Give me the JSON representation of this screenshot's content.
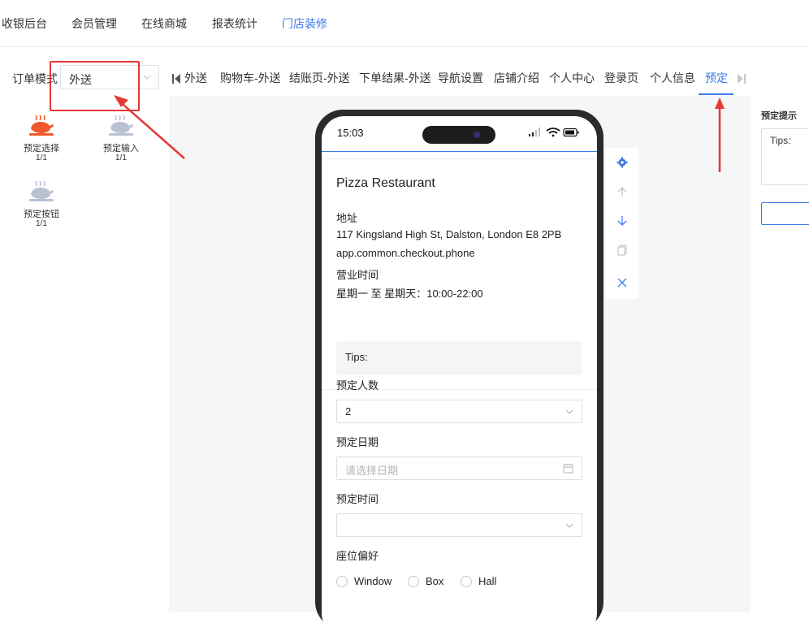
{
  "topnav": {
    "items": [
      {
        "label": "收银后台",
        "active": false
      },
      {
        "label": "会员管理",
        "active": false
      },
      {
        "label": "在线商城",
        "active": false
      },
      {
        "label": "报表统计",
        "active": false
      },
      {
        "label": "门店装修",
        "active": true
      }
    ]
  },
  "order_mode": {
    "label": "订单模式",
    "selected": "外送"
  },
  "components": [
    {
      "name": "预定选择",
      "count": "1/1",
      "icon": "roast-chicken-icon",
      "active": true
    },
    {
      "name": "预定输入",
      "count": "1/1",
      "icon": "roast-chicken-icon",
      "active": false
    },
    {
      "name": "预定按钮",
      "count": "1/1",
      "icon": "roast-chicken-icon",
      "active": false
    }
  ],
  "tabs": {
    "items": [
      {
        "label": "外送"
      },
      {
        "label": "购物车-外送"
      },
      {
        "label": "结账页-外送"
      },
      {
        "label": "下单结果-外送"
      },
      {
        "label": "导航设置"
      },
      {
        "label": "店铺介绍"
      },
      {
        "label": "个人中心"
      },
      {
        "label": "登录页"
      },
      {
        "label": "个人信息"
      },
      {
        "label": "预定"
      }
    ],
    "active_label": "预定"
  },
  "phone": {
    "time": "15:03",
    "restaurant_name": "Pizza Restaurant",
    "address_label": "地址",
    "address": "117 Kingsland High St, Dalston, London E8 2PB",
    "phone_key": "app.common.checkout.phone",
    "hours_label": "营业时间",
    "hours": "星期一 至 星期天：10:00-22:00",
    "tips": "Tips:",
    "party_size_label": "预定人数",
    "party_size_value": "2",
    "date_label": "预定日期",
    "date_placeholder": "请选择日期",
    "time_label": "预定时间",
    "time_value": "",
    "seat_label": "座位偏好",
    "seat_options": [
      "Window",
      "Box",
      "Hall"
    ]
  },
  "right_panel": {
    "title": "预定提示",
    "tips_value": "Tips:",
    "input_value": ""
  },
  "colors": {
    "accent": "#3d7ae6",
    "annotation_red": "#e53935",
    "icon_active": "#f0582c",
    "icon_inactive": "#b9c1d3"
  }
}
